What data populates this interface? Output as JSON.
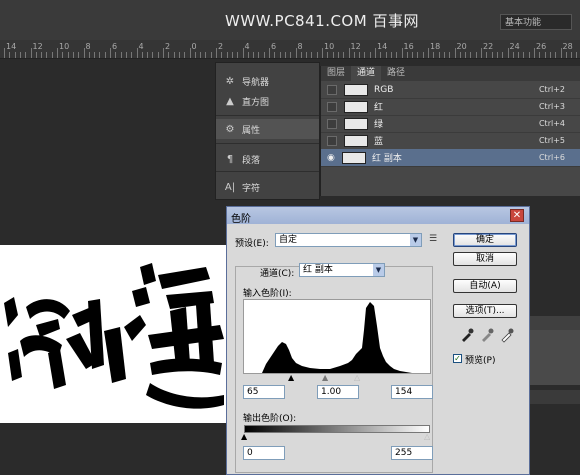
{
  "watermark": "WWW.PC841.COM 百事网",
  "workspace": {
    "label": "基本功能"
  },
  "ruler": {
    "labels": [
      "14",
      "12",
      "10",
      "8",
      "6",
      "4",
      "2",
      "0",
      "2",
      "4",
      "6",
      "8",
      "10",
      "12",
      "14",
      "16",
      "18",
      "20",
      "22",
      "24",
      "26",
      "28"
    ]
  },
  "dock": {
    "items": [
      {
        "label": "导航器",
        "icon": "navigator-icon"
      },
      {
        "label": "直方图",
        "icon": "histogram-icon"
      },
      {
        "label": "属性",
        "icon": "properties-icon"
      },
      {
        "label": "段落",
        "icon": "paragraph-icon"
      },
      {
        "label": "字符",
        "icon": "character-icon"
      }
    ]
  },
  "channels": {
    "tabs": [
      "图层",
      "通道",
      "路径"
    ],
    "active_tab": 1,
    "rows": [
      {
        "name": "RGB",
        "shortcut": "Ctrl+2",
        "visible": false,
        "selected": false
      },
      {
        "name": "红",
        "shortcut": "Ctrl+3",
        "visible": false,
        "selected": false
      },
      {
        "name": "绿",
        "shortcut": "Ctrl+4",
        "visible": false,
        "selected": false
      },
      {
        "name": "蓝",
        "shortcut": "Ctrl+5",
        "visible": false,
        "selected": false
      },
      {
        "name": "红 副本",
        "shortcut": "Ctrl+6",
        "visible": true,
        "selected": true
      }
    ]
  },
  "dialog": {
    "title": "色阶",
    "preset_label": "预设(E):",
    "preset_value": "自定",
    "channel_label": "通道(C):",
    "channel_value": "红 副本",
    "input_levels_label": "输入色阶(I):",
    "input_values": [
      "65",
      "1.00",
      "154"
    ],
    "output_levels_label": "输出色阶(O):",
    "output_values": [
      "0",
      "255"
    ],
    "buttons": {
      "ok": "确定",
      "cancel": "取消",
      "auto": "自动(A)",
      "options": "选项(T)..."
    },
    "preview_label": "预览(P)",
    "preview_checked": true
  },
  "colors": {
    "dialog_title": "#b4c4e0",
    "selection": "#5a6f8d",
    "close": "#c9463d"
  }
}
